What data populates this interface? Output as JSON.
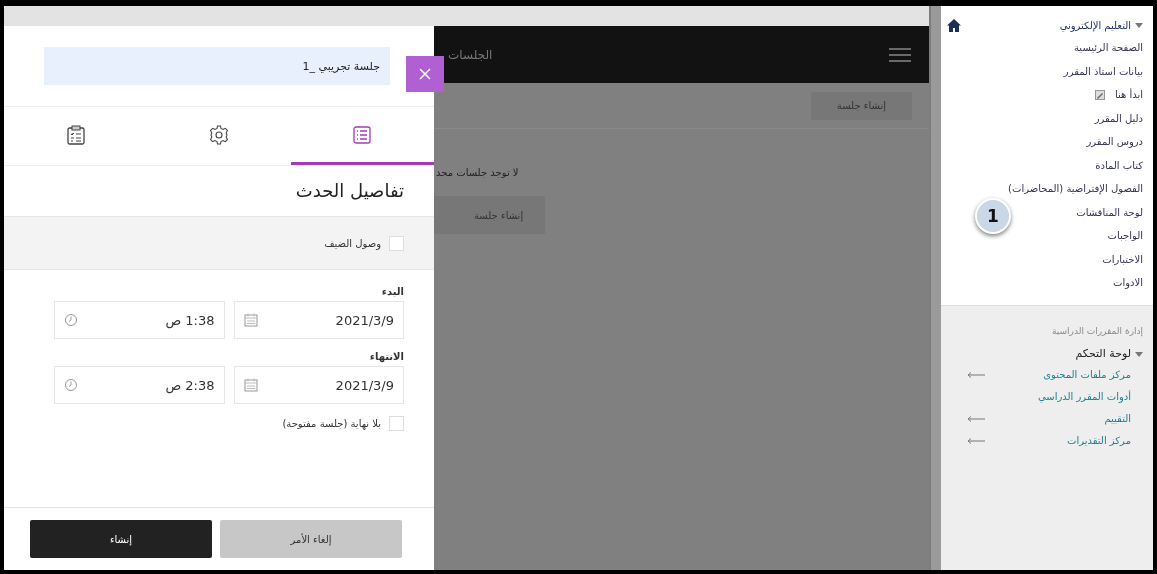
{
  "panel": {
    "title_field": {
      "value": "جلسة تجريبي _1"
    },
    "tabs": [
      {
        "kind": "details",
        "selected": true
      },
      {
        "kind": "settings",
        "selected": false
      },
      {
        "kind": "attendance",
        "selected": false
      }
    ],
    "section_title": "تفاصيل الحدث",
    "guest_access": {
      "label": "وصول الضيف",
      "checked": false
    },
    "start": {
      "label": "البدء",
      "date": "2021/3/9",
      "time": "1:38 ص"
    },
    "end": {
      "label": "الانتهاء",
      "date": "2021/3/9",
      "time": "2:38 ص"
    },
    "no_end": {
      "label": "بلا نهاية (جلسة مفتوحة)",
      "checked": false
    },
    "buttons": [
      {
        "label": "إلغاء الأمر",
        "kind": "secondary"
      },
      {
        "label": "إنشاء",
        "kind": "primary"
      }
    ]
  },
  "page": {
    "title": "الجلسات",
    "toolbar_button": "إنشاء جلسة",
    "empty_message": "لا توجد جلسات محد",
    "empty_button": "إنشاء جلسة"
  },
  "sidebar": {
    "course_menu": {
      "title": "التعليم الإلكتروني",
      "expanded": true,
      "items": [
        {
          "label": "الصفحة الرئيسية",
          "kind": "link"
        },
        {
          "label": "بيانات استاذ المقرر",
          "kind": "link"
        },
        {
          "label": "ابدأ هنا",
          "kind": "with-icon"
        },
        {
          "label": "دليل المقرر",
          "kind": "link"
        },
        {
          "label": "دروس المقرر",
          "kind": "link"
        },
        {
          "label": "كتاب المادة",
          "kind": "link"
        },
        {
          "label": "الفصول الإفتراضية (المحاضرات)",
          "kind": "link"
        },
        {
          "label": "لوحة المناقشات",
          "kind": "link"
        },
        {
          "label": "الواجبات",
          "kind": "link"
        },
        {
          "label": "الاختبارات",
          "kind": "link"
        },
        {
          "label": "الادوات",
          "kind": "link"
        }
      ]
    },
    "management": {
      "title": "إدارة المقررات الدراسية",
      "control_panel": {
        "title": "لوحة التحكم",
        "expanded": true,
        "items": [
          {
            "label": "مركز ملفات المحتوى",
            "has_arrow": true
          },
          {
            "label": "أدوات المقرر الدراسي",
            "has_arrow": false
          },
          {
            "label": "التقييم",
            "has_arrow": true
          },
          {
            "label": "مركز التقديرات",
            "has_arrow": true
          }
        ]
      }
    }
  },
  "callout": "1"
}
